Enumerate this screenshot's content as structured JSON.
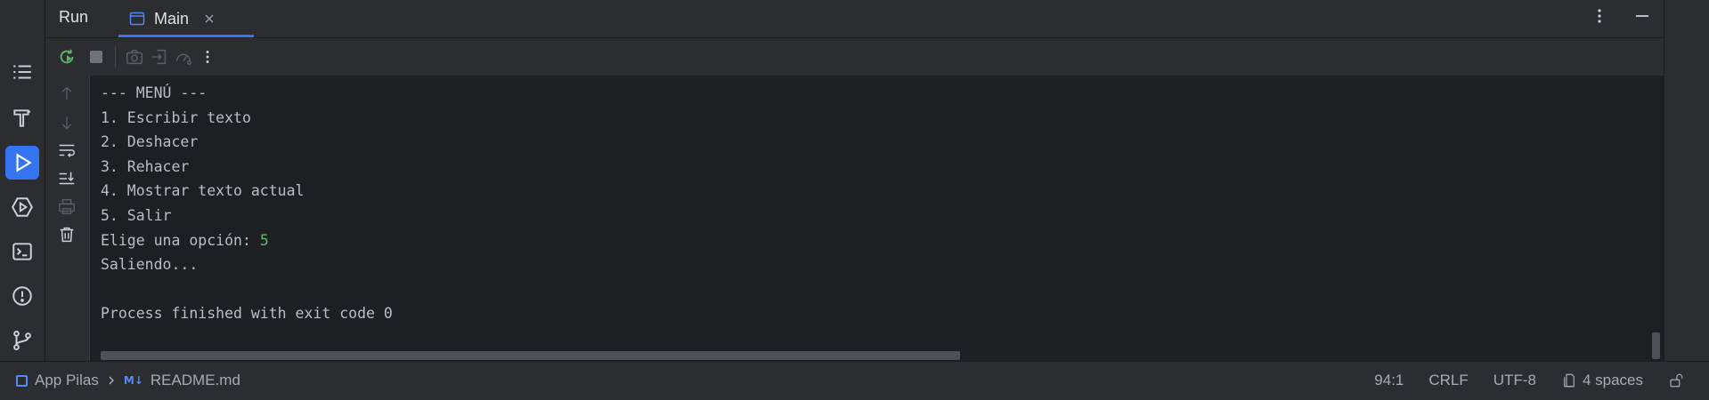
{
  "run_window": {
    "title": "Run",
    "tab": {
      "label": "Main"
    }
  },
  "console": {
    "lines": [
      "--- MENÚ ---",
      "1. Escribir texto",
      "2. Deshacer",
      "3. Rehacer",
      "4. Mostrar texto actual",
      "5. Salir"
    ],
    "prompt": "Elige una opción: ",
    "input_value": "5",
    "after_lines": [
      "Saliendo...",
      "",
      "Process finished with exit code 0"
    ]
  },
  "statusbar": {
    "project": "App Pilas",
    "file_badge": "M↓",
    "file": "README.md",
    "position": "94:1",
    "line_separator": "CRLF",
    "encoding": "UTF-8",
    "indent": "4 spaces"
  },
  "icons": {
    "activity": [
      "structure-icon",
      "build-icon",
      "run-icon",
      "services-icon",
      "terminal-icon",
      "problems-icon",
      "git-icon"
    ],
    "toolbar": [
      "rerun-icon",
      "stop-icon",
      "screenshot-icon",
      "restore-layout-icon",
      "profiler-icon",
      "more-icon"
    ],
    "gutter": [
      "scroll-up-icon",
      "scroll-down-icon",
      "soft-wrap-icon",
      "scroll-to-end-icon",
      "print-icon",
      "clear-all-icon"
    ]
  },
  "colors": {
    "accent": "#3574f0",
    "input_text": "#5fb865",
    "background": "#1e1f22",
    "panel": "#2b2d30"
  }
}
